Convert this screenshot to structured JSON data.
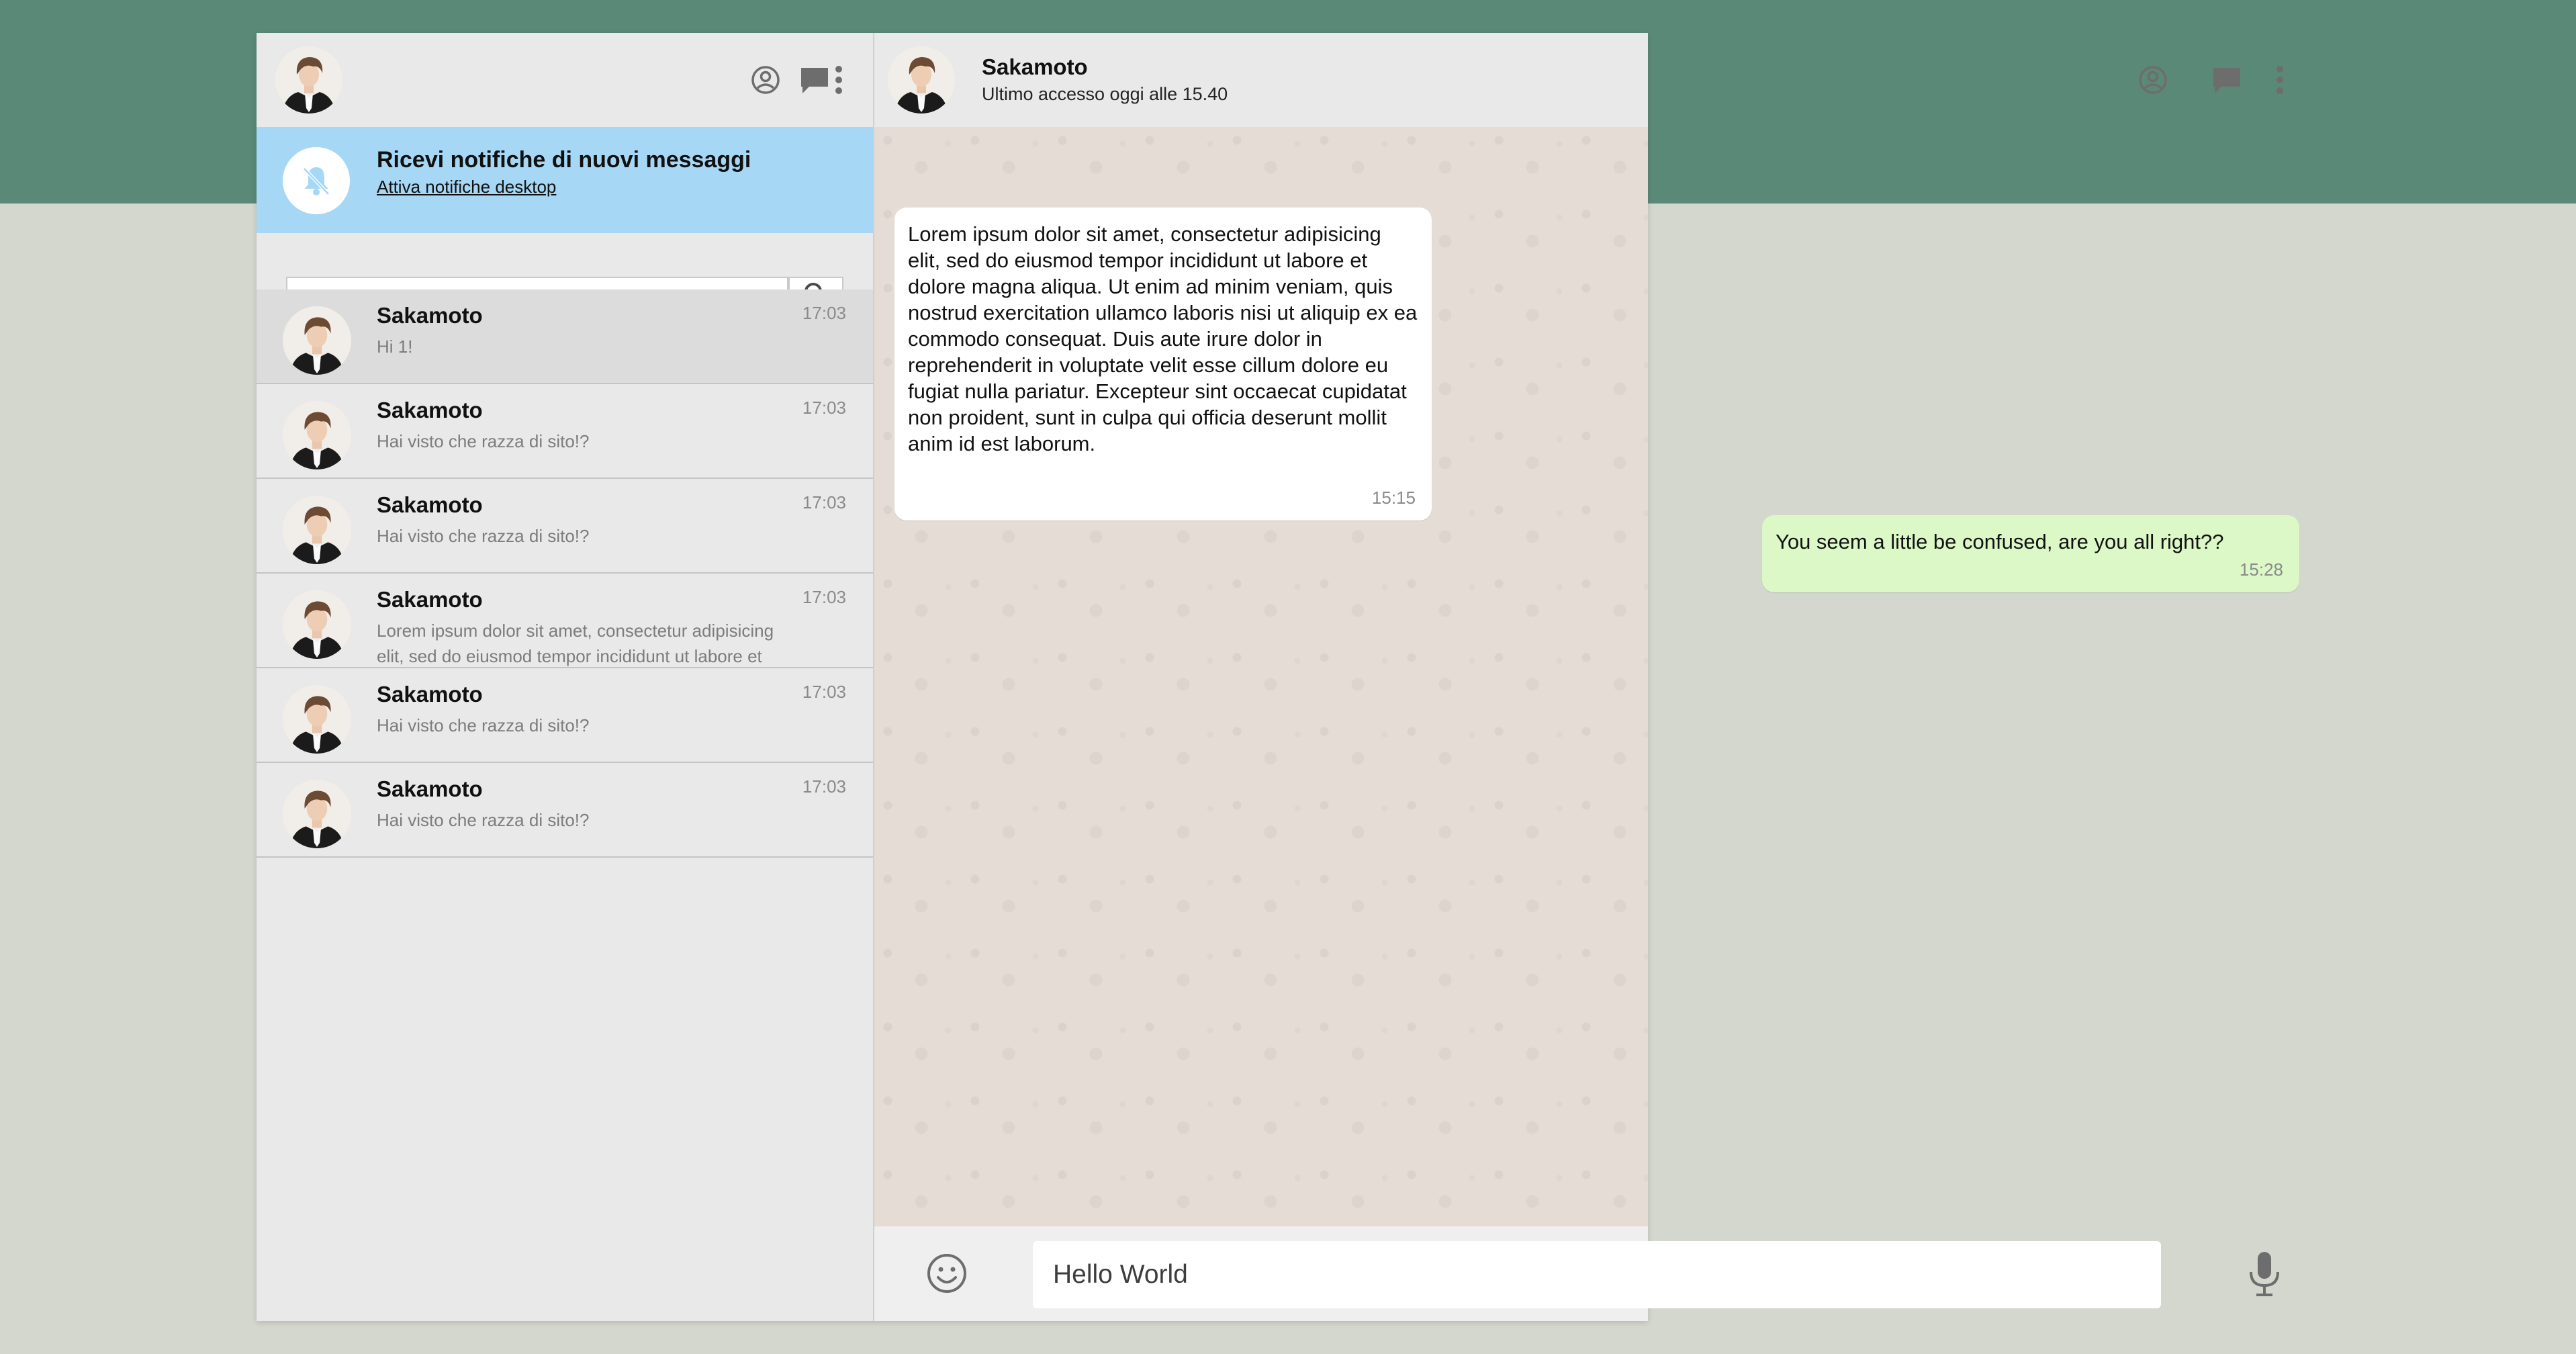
{
  "theme": {
    "top_band": "#5b8978",
    "page_bg": "#d4d7cd",
    "notify_bg": "#a6d8f5",
    "outgoing_bubble": "#dcf8c6",
    "incoming_bubble": "#ffffff",
    "chat_bg": "#e5ddd5"
  },
  "left_header": {
    "icons": [
      "status-icon",
      "new-chat-icon",
      "menu-icon"
    ]
  },
  "notification": {
    "title": "Ricevi notifiche di nuovi messaggi",
    "link": "Attiva notifiche desktop",
    "icon": "bell-off-icon"
  },
  "search": {
    "placeholder": "",
    "value": ""
  },
  "chats": [
    {
      "name": "Sakamoto",
      "time": "17:03",
      "preview": "Hi 1!"
    },
    {
      "name": "Sakamoto",
      "time": "17:03",
      "preview": "Hai visto che razza di sito!?"
    },
    {
      "name": "Sakamoto",
      "time": "17:03",
      "preview": "Hai visto che razza di sito!?"
    },
    {
      "name": "Sakamoto",
      "time": "17:03",
      "preview": "Lorem ipsum dolor sit amet, consectetur adipisicing elit, sed do eiusmod tempor incididunt ut labore et"
    },
    {
      "name": "Sakamoto",
      "time": "17:03",
      "preview": "Hai visto che razza di sito!?"
    },
    {
      "name": "Sakamoto",
      "time": "17:03",
      "preview": "Hai visto che razza di sito!?"
    }
  ],
  "conversation": {
    "contact_name": "Sakamoto",
    "status": "Ultimo accesso oggi alle 15.40",
    "messages": [
      {
        "direction": "in",
        "text": "Lorem ipsum dolor sit amet, consectetur adipisicing elit, sed do eiusmod tempor incididunt ut labore et dolore magna aliqua. Ut enim ad minim veniam, quis nostrud exercitation ullamco laboris nisi ut aliquip ex ea commodo consequat. Duis aute irure dolor in reprehenderit in voluptate velit esse cillum dolore eu fugiat nulla pariatur. Excepteur sint occaecat cupidatat non proident, sunt in culpa qui officia deserunt mollit anim id est laborum.",
        "time": "15:15"
      },
      {
        "direction": "out",
        "text": "You seem a little be confused, are you all right??",
        "time": "15:28"
      }
    ]
  },
  "composer": {
    "value": "Hello World",
    "emoji_icon": "smiley-icon",
    "mic_icon": "microphone-icon"
  }
}
